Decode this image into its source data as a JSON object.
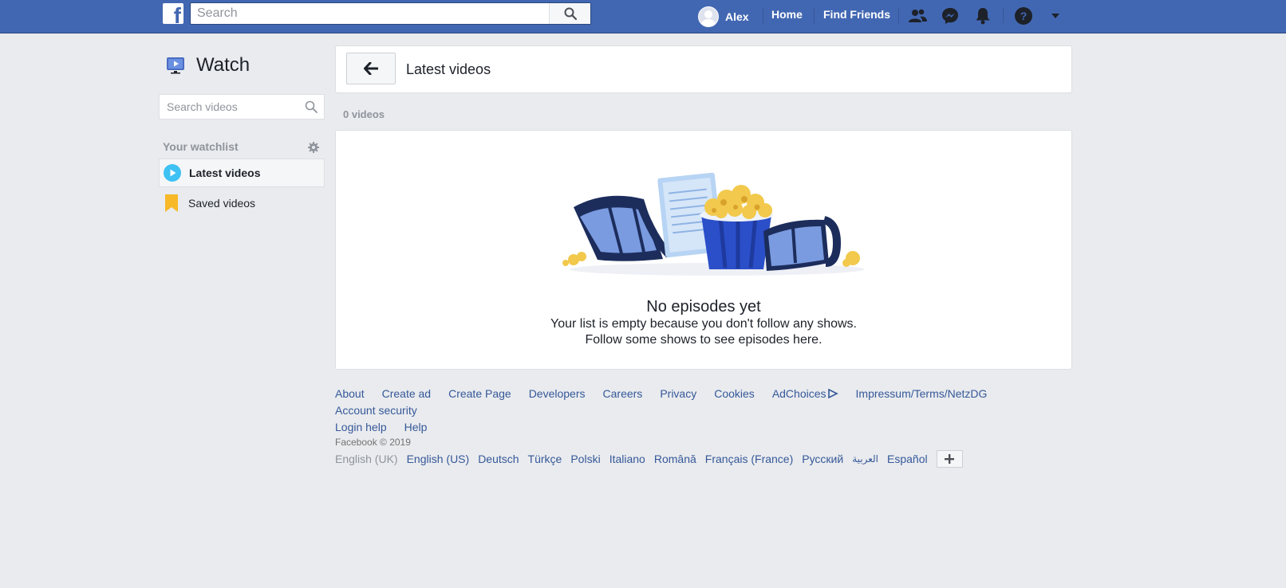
{
  "topbar": {
    "logo_letter": "f",
    "search_placeholder": "Search",
    "user_name": "Alex",
    "home": "Home",
    "find_friends": "Find Friends",
    "icons": [
      "friend-requests-icon",
      "messenger-icon",
      "notifications-icon",
      "help-icon",
      "account-menu-icon"
    ],
    "brand_color": "#4267b2"
  },
  "sidebar": {
    "title": "Watch",
    "search_placeholder": "Search videos",
    "watchlist_title": "Your watchlist",
    "items": [
      {
        "label": "Latest videos",
        "icon": "play-circle-icon",
        "active": true
      },
      {
        "label": "Saved videos",
        "icon": "bookmark-icon",
        "active": false
      }
    ]
  },
  "main": {
    "header_title": "Latest videos",
    "count": "0 videos",
    "empty_title": "No episodes yet",
    "empty_line1": "Your list is empty because you don't follow any shows.",
    "empty_line2": "Follow some shows to see episodes here."
  },
  "footer": {
    "links": [
      "About",
      "Create ad",
      "Create Page",
      "Developers",
      "Careers",
      "Privacy",
      "Cookies",
      "AdChoices",
      "Impressum/Terms/NetzDG",
      "Account security",
      "Login help",
      "Help"
    ],
    "copyright": "Facebook © 2019",
    "current_language": "English (UK)",
    "languages": [
      "English (US)",
      "Deutsch",
      "Türkçe",
      "Polski",
      "Italiano",
      "Română",
      "Français (France)",
      "Русский",
      "العربية",
      "Español"
    ]
  }
}
